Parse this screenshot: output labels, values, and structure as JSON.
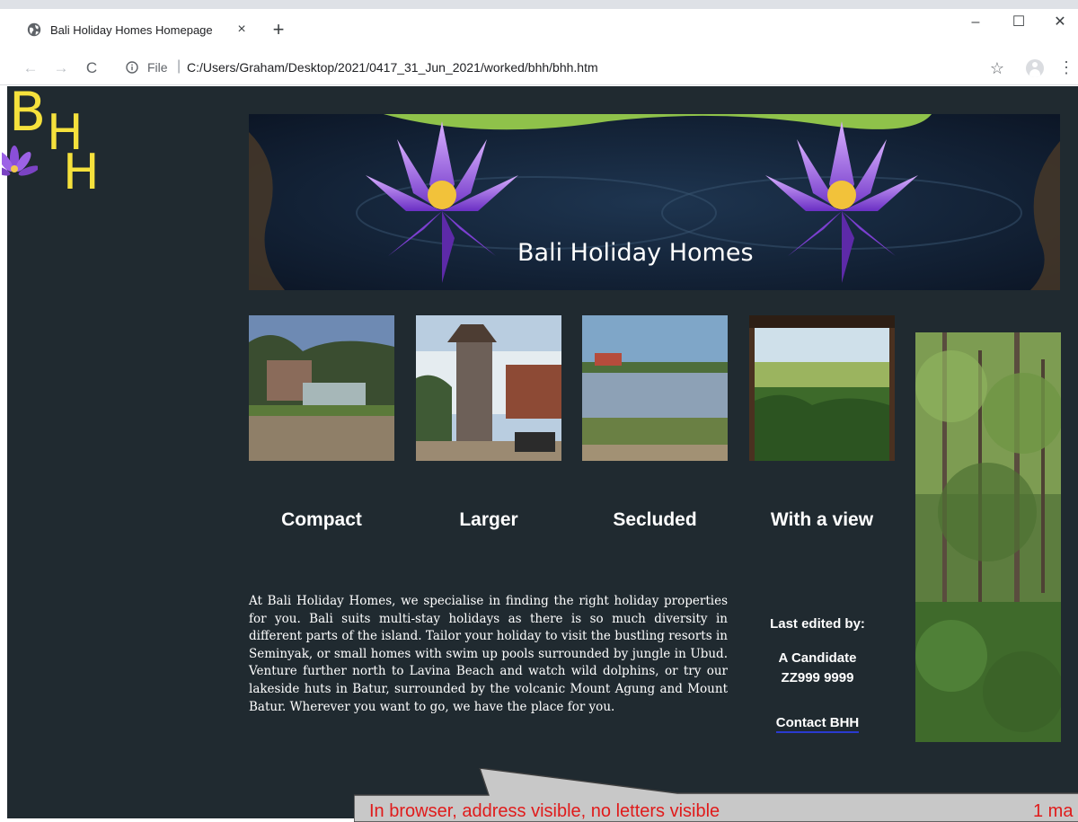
{
  "browser": {
    "tab_title": "Bali Holiday Homes Homepage",
    "tab_close": "×",
    "new_tab": "+",
    "window_minimize": "–",
    "window_maximize": "☐",
    "window_close": "✕",
    "nav_back": "←",
    "nav_forward": "→",
    "nav_reload": "C",
    "address_scheme": "File",
    "address_separator": "|",
    "address_url": "C:/Users/Graham/Desktop/2021/0417_31_Jun_2021/worked/bhh/bhh.htm",
    "bookmark_star": "☆",
    "menu_dots": "⋮"
  },
  "page": {
    "logo": {
      "b": "B",
      "h1": "H",
      "h2": "H"
    },
    "banner_title": "Bali Holiday Homes",
    "categories": [
      "Compact",
      "Larger",
      "Secluded",
      "With a view"
    ],
    "intro_text": "At Bali Holiday Homes, we specialise in finding the right holiday properties for you. Bali suits multi-stay holidays as there is so much diversity in different parts of the island. Tailor your holiday to visit the bustling resorts in Seminyak, or small homes with swim up pools surrounded by jungle in Ubud. Venture further north to Lavina Beach and watch wild dolphins, or try our lakeside huts in Batur, surrounded by the volcanic Mount Agung and Mount Batur. Wherever you want to go, we have the place for you.",
    "last_edited_label": "Last edited by:",
    "editor_name": "A Candidate",
    "candidate_number": "ZZ999 9999",
    "contact_link": "Contact BHH"
  },
  "annotation": {
    "comment": "In browser, address visible, no letters visible",
    "mark": "1 ma"
  },
  "colors": {
    "page_background": "#202a30",
    "logo_yellow": "#f5e13c",
    "link_underline": "#2a3ad0",
    "annotation_red": "#e01b1b"
  }
}
